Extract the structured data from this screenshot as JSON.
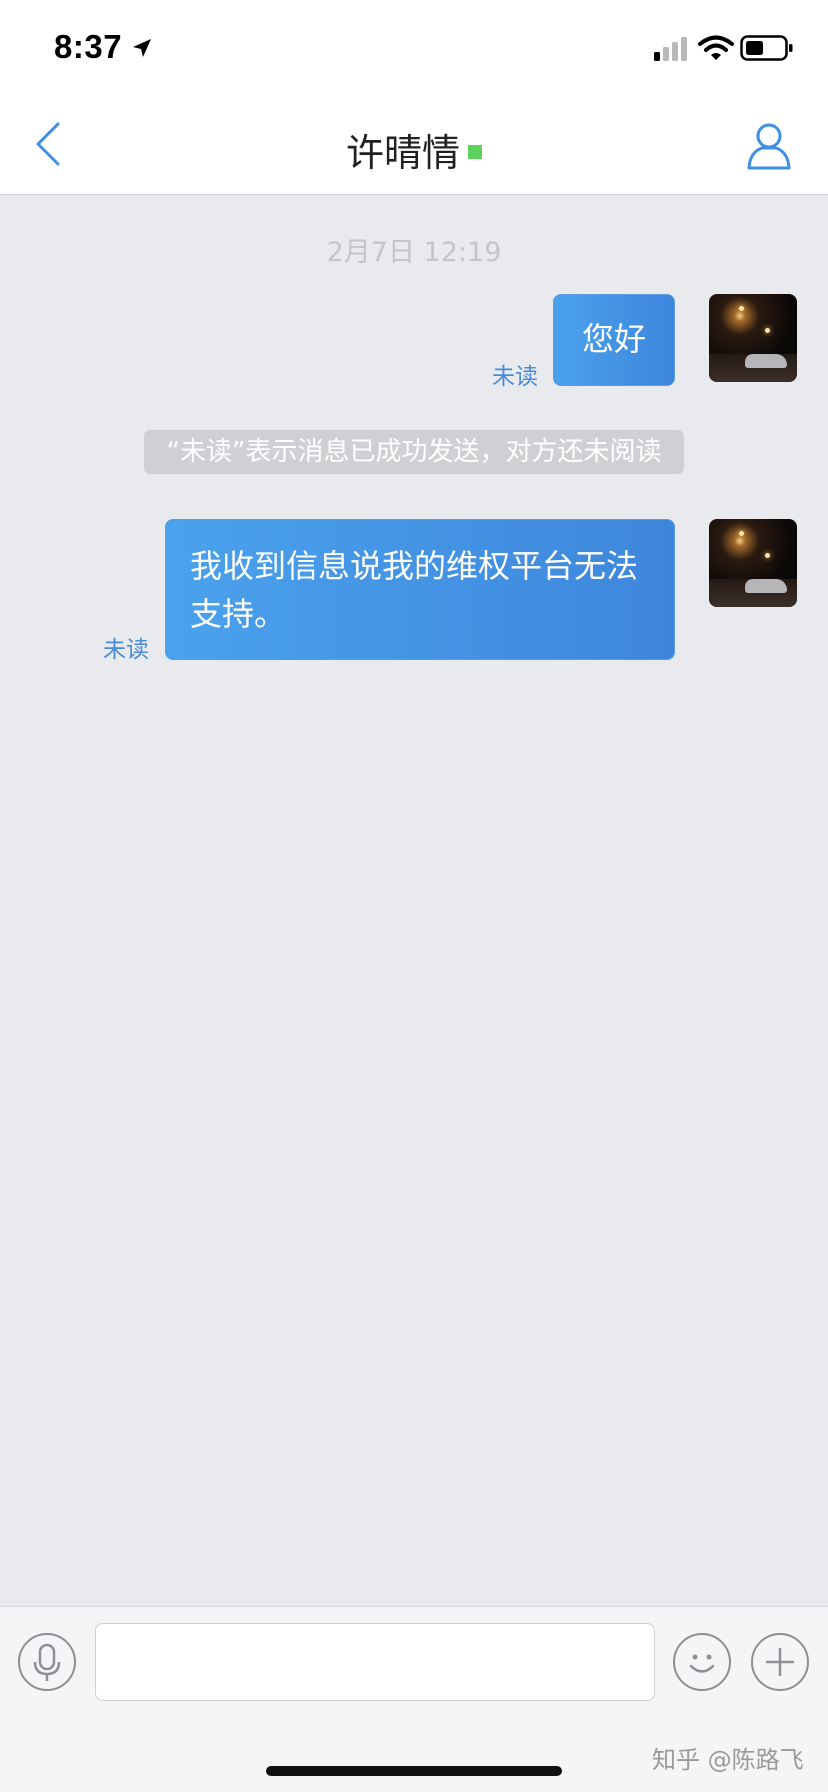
{
  "status_bar": {
    "time": "8:37"
  },
  "header": {
    "title": "许晴情",
    "back_icon": "chevron-left-icon",
    "profile_icon": "person-icon",
    "online_color": "#5cd15c"
  },
  "chat": {
    "timestamp": "2月7日 12:19",
    "messages": [
      {
        "text": "您好",
        "status": "未读"
      },
      {
        "text": "我收到信息说我的维权平台无法支持。",
        "status": "未读"
      }
    ],
    "system_note": "“未读”表示消息已成功发送，对方还未阅读"
  },
  "input_bar": {
    "mic_icon": "microphone-icon",
    "emoji_icon": "smiley-icon",
    "plus_icon": "plus-icon",
    "value": ""
  },
  "watermark": "知乎 @陈路飞",
  "colors": {
    "bubble": "#4096e6",
    "unread_text": "#4a8bd8",
    "background": "#e9eaee"
  }
}
